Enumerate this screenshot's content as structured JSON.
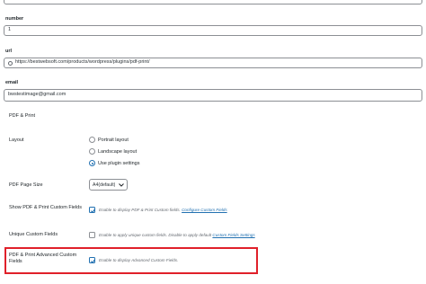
{
  "fields": {
    "number": {
      "label": "number",
      "value": "1"
    },
    "url": {
      "label": "url",
      "value": "https://bestwebsoft.com/products/wordpress/plugins/pdf-print/"
    },
    "email": {
      "label": "email",
      "value": "bwstestimage@gmail.com"
    }
  },
  "section": {
    "title": "PDF & Print",
    "layout": {
      "label": "Layout",
      "options": [
        "Portrait layout",
        "Landscape layout",
        "Use plugin settings"
      ],
      "selected": "Use plugin settings"
    },
    "page_size": {
      "label": "PDF Page Size",
      "value": "A4(default)"
    },
    "custom_fields": {
      "label": "Show PDF & Print Custom Fields",
      "checked": true,
      "desc": "Enable to display PDF & Print Custom fields.",
      "link": "Configure Custom Fields"
    },
    "unique_fields": {
      "label": "Unique Custom Fields",
      "checked": false,
      "desc": "Enable to apply unique custom fields. Disable to apply default",
      "link": "Custom Fields Settings"
    },
    "acf": {
      "label": "PDF & Print Advanced Custom Fields",
      "checked": true,
      "desc": "Enable to display Advanced Custom Fields."
    }
  },
  "colors": {
    "accent": "#2271b1",
    "highlight": "#e0202a"
  }
}
